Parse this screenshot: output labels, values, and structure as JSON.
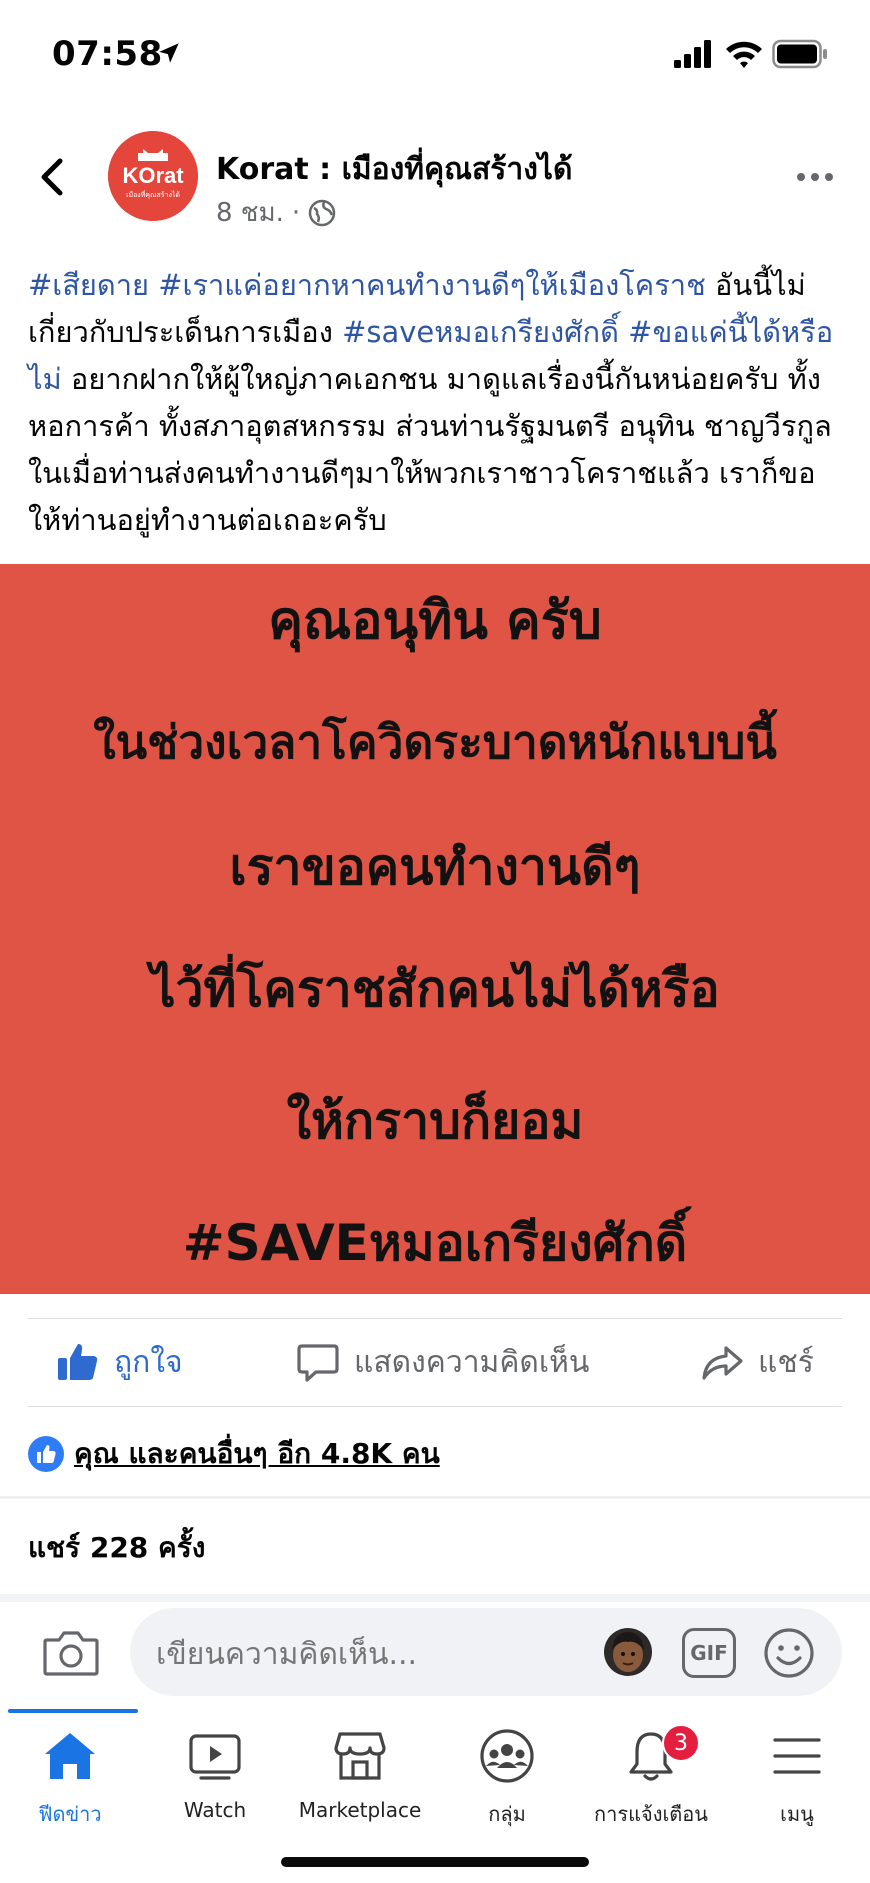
{
  "status_bar": {
    "time": "07:58",
    "icons": [
      "location-arrow-icon",
      "cellular-signal-icon",
      "wifi-icon",
      "battery-icon"
    ]
  },
  "post": {
    "page_name": "Korat : เมืองที่คุณสร้างได้",
    "avatar": {
      "brand": "KOrat",
      "tagline": "เมืองที่คุณสร้างได้"
    },
    "time_ago": "8 ชม.",
    "separator": "·",
    "text_segments": [
      {
        "text": "#เสียดาย",
        "type": "hashtag"
      },
      {
        "text": " ",
        "type": "plain"
      },
      {
        "text": "#เราแค่อยากหาคนทำงานดีๆให้เมืองโคราช",
        "type": "hashtag"
      },
      {
        "text": " อันนี้ไม่เกี่ยวกับประเด็นการเมือง ",
        "type": "plain"
      },
      {
        "text": "#saveหมอเกรียงศักดิ์",
        "type": "hashtag"
      },
      {
        "text": " ",
        "type": "plain"
      },
      {
        "text": "#ขอแค่นี้ได้หรือไม่",
        "type": "hashtag"
      },
      {
        "text": " อยากฝากให้ผู้ใหญ่ภาคเอกชน มาดูแลเรื่องนี้กันหน่อยครับ ทั้งหอการค้า ทั้งสภาอุตสหกรรม ส่วนท่านรัฐมนตรี อนุทิน ชาญวีรกูล ในเมื่อท่านส่งคนทำงานดีๆมาให้พวกเราชาวโคราชแล้ว เราก็ขอให้ท่านอยู่ทำงานต่อเถอะครับ",
        "type": "plain"
      }
    ],
    "image_lines": [
      "คุณอนุทิน ครับ",
      "ในช่วงเวลาโควิดระบาดหนักแบบนี้",
      "เราขอคนทำงานดีๆ",
      "ไว้ที่โคราชสักคนไม่ได้หรือ",
      "ให้กราบก็ยอม",
      "#SAVEหมอเกรียงศักดิ์"
    ],
    "image_bg_color": "#df5445",
    "actions": {
      "like": "ถูกใจ",
      "comment": "แสดงความคิดเห็น",
      "share": "แชร์"
    },
    "reactions_text": "คุณ และคนอื่นๆ อีก 4.8K คน",
    "shares_text": "แชร์ 228 ครั้ง"
  },
  "composer": {
    "placeholder": "เขียนความคิดเห็น...",
    "gif_label": "GIF"
  },
  "tabs": [
    {
      "label": "ฟีดข่าว",
      "icon": "home-icon",
      "active": true
    },
    {
      "label": "Watch",
      "icon": "watch-icon"
    },
    {
      "label": "Marketplace",
      "icon": "marketplace-icon"
    },
    {
      "label": "กลุ่ม",
      "icon": "groups-icon"
    },
    {
      "label": "การแจ้งเตือน",
      "icon": "bell-icon",
      "badge": "3"
    },
    {
      "label": "เมนู",
      "icon": "menu-icon"
    }
  ],
  "colors": {
    "accent": "#1b74e4",
    "hashtag": "#2f56a3",
    "badge": "#e41e3f"
  }
}
